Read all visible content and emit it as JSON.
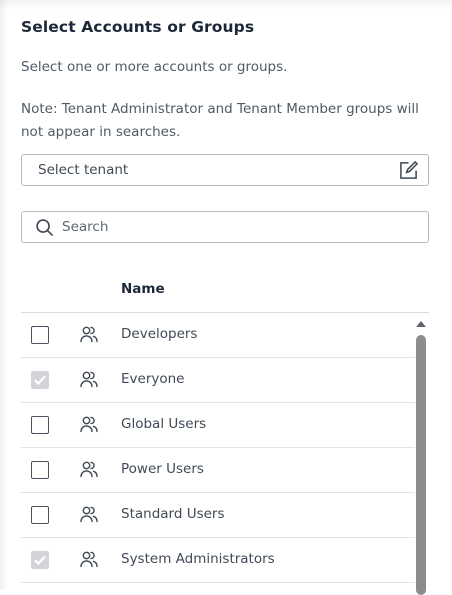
{
  "dialog": {
    "title": "Select Accounts or Groups",
    "subtitle": "Select one or more accounts or groups.",
    "note": "Note: Tenant Administrator and Tenant Member groups will not appear in searches."
  },
  "tenant_select": {
    "placeholder": "Select tenant",
    "icon": "edit-icon"
  },
  "search": {
    "placeholder": "Search",
    "value": "",
    "icon": "search-icon"
  },
  "table": {
    "columns": [
      "Name"
    ],
    "rows": [
      {
        "name": "Developers",
        "checked": false,
        "icon": "group-icon"
      },
      {
        "name": "Everyone",
        "checked": true,
        "icon": "group-icon"
      },
      {
        "name": "Global Users",
        "checked": false,
        "icon": "group-icon"
      },
      {
        "name": "Power Users",
        "checked": false,
        "icon": "group-icon"
      },
      {
        "name": "Standard Users",
        "checked": false,
        "icon": "group-icon"
      },
      {
        "name": "System Administrators",
        "checked": true,
        "icon": "group-icon"
      }
    ]
  },
  "colors": {
    "checkbox_border": "#4a5260",
    "checkbox_disabled_checked": "#d2d4d8",
    "scrollbar": "#8c8c8c"
  }
}
